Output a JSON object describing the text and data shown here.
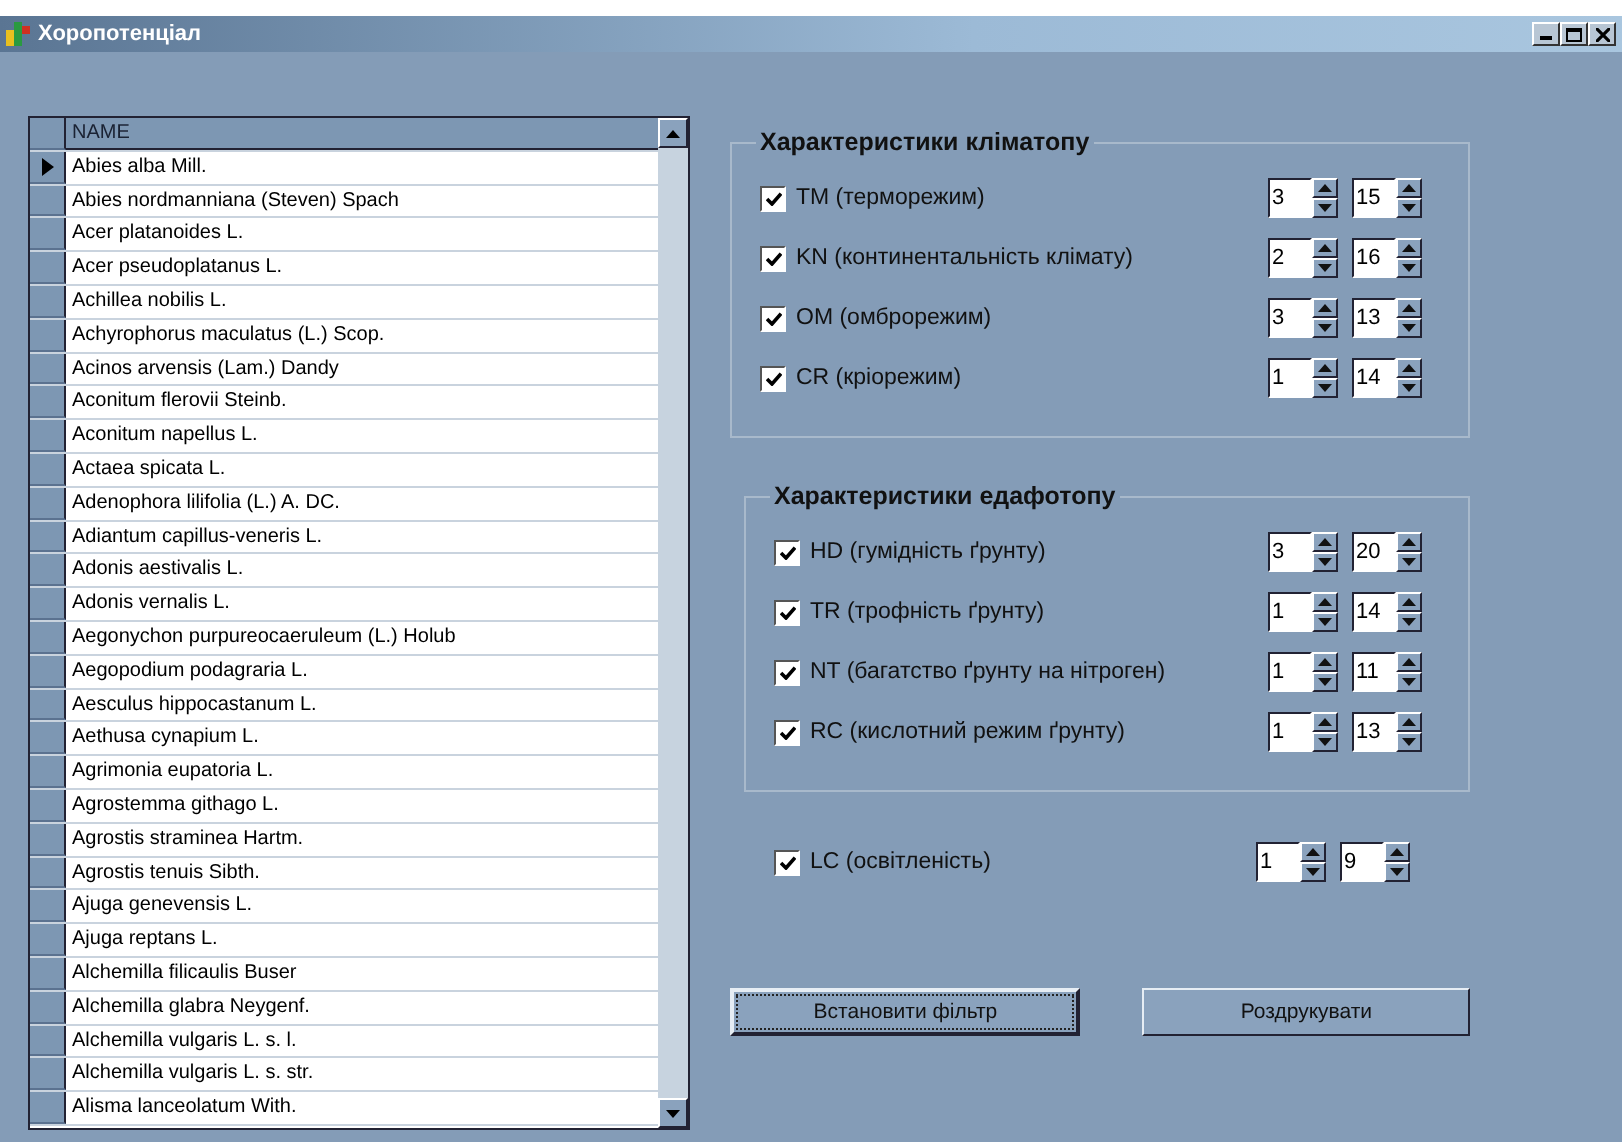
{
  "window": {
    "title": "Хоропотенціал"
  },
  "grid": {
    "columns": [
      "NAME"
    ],
    "rows": [
      {
        "name": "Abies alba Mill.",
        "selected": true
      },
      {
        "name": "Abies nordmanniana (Steven) Spach",
        "selected": false
      },
      {
        "name": "Acer platanoides L.",
        "selected": false
      },
      {
        "name": "Acer pseudoplatanus L.",
        "selected": false
      },
      {
        "name": "Achillea nobilis L.",
        "selected": false
      },
      {
        "name": "Achyrophorus maculatus (L.) Scop.",
        "selected": false
      },
      {
        "name": "Acinos arvensis (Lam.) Dandy",
        "selected": false
      },
      {
        "name": "Aconitum flerovii Steinb.",
        "selected": false
      },
      {
        "name": "Aconitum napellus L.",
        "selected": false
      },
      {
        "name": "Actaea spicata L.",
        "selected": false
      },
      {
        "name": "Adenophora lilifolia (L.) A. DC.",
        "selected": false
      },
      {
        "name": "Adiantum capillus-veneris L.",
        "selected": false
      },
      {
        "name": "Adonis aestivalis L.",
        "selected": false
      },
      {
        "name": "Adonis vernalis L.",
        "selected": false
      },
      {
        "name": "Aegonychon purpureocaeruleum (L.) Holub",
        "selected": false
      },
      {
        "name": "Aegopodium podagraria L.",
        "selected": false
      },
      {
        "name": "Aesculus hippocastanum L.",
        "selected": false
      },
      {
        "name": "Aethusa cynapium L.",
        "selected": false
      },
      {
        "name": "Agrimonia eupatoria L.",
        "selected": false
      },
      {
        "name": "Agrostemma githago L.",
        "selected": false
      },
      {
        "name": "Agrostis straminea Hartm.",
        "selected": false
      },
      {
        "name": "Agrostis tenuis Sibth.",
        "selected": false
      },
      {
        "name": "Ajuga genevensis L.",
        "selected": false
      },
      {
        "name": "Ajuga reptans L.",
        "selected": false
      },
      {
        "name": "Alchemilla filicaulis Buser",
        "selected": false
      },
      {
        "name": "Alchemilla glabra Neygenf.",
        "selected": false
      },
      {
        "name": "Alchemilla vulgaris L. s. l.",
        "selected": false
      },
      {
        "name": "Alchemilla vulgaris L. s. str.",
        "selected": false
      },
      {
        "name": "Alisma lanceolatum With.",
        "selected": false
      }
    ]
  },
  "groups": [
    {
      "title": "Характеристики кліматопу",
      "rows": [
        {
          "label": "TM (терморежим)",
          "checked": true,
          "min": "3",
          "max": "15"
        },
        {
          "label": "KN (континентальність клімату)",
          "checked": true,
          "min": "2",
          "max": "16"
        },
        {
          "label": "OM (омброрежим)",
          "checked": true,
          "min": "3",
          "max": "13"
        },
        {
          "label": "CR (кріорежим)",
          "checked": true,
          "min": "1",
          "max": "14"
        }
      ]
    },
    {
      "title": "Характеристики едафотопу",
      "rows": [
        {
          "label": "HD (гумідність ґрунту)",
          "checked": true,
          "min": "3",
          "max": "20"
        },
        {
          "label": "TR (трофність ґрунту)",
          "checked": true,
          "min": "1",
          "max": "14"
        },
        {
          "label": "NT (багатство ґрунту на нітроген)",
          "checked": true,
          "min": "1",
          "max": "11"
        },
        {
          "label": "RC (кислотний режим ґрунту)",
          "checked": true,
          "min": "1",
          "max": "13"
        }
      ]
    }
  ],
  "extra_row": {
    "label": "LC (освітленість)",
    "checked": true,
    "min": "1",
    "max": "9"
  },
  "buttons": [
    {
      "label": "Встановити фільтр",
      "focused": true
    },
    {
      "label": "Роздрукувати",
      "focused": false
    }
  ]
}
